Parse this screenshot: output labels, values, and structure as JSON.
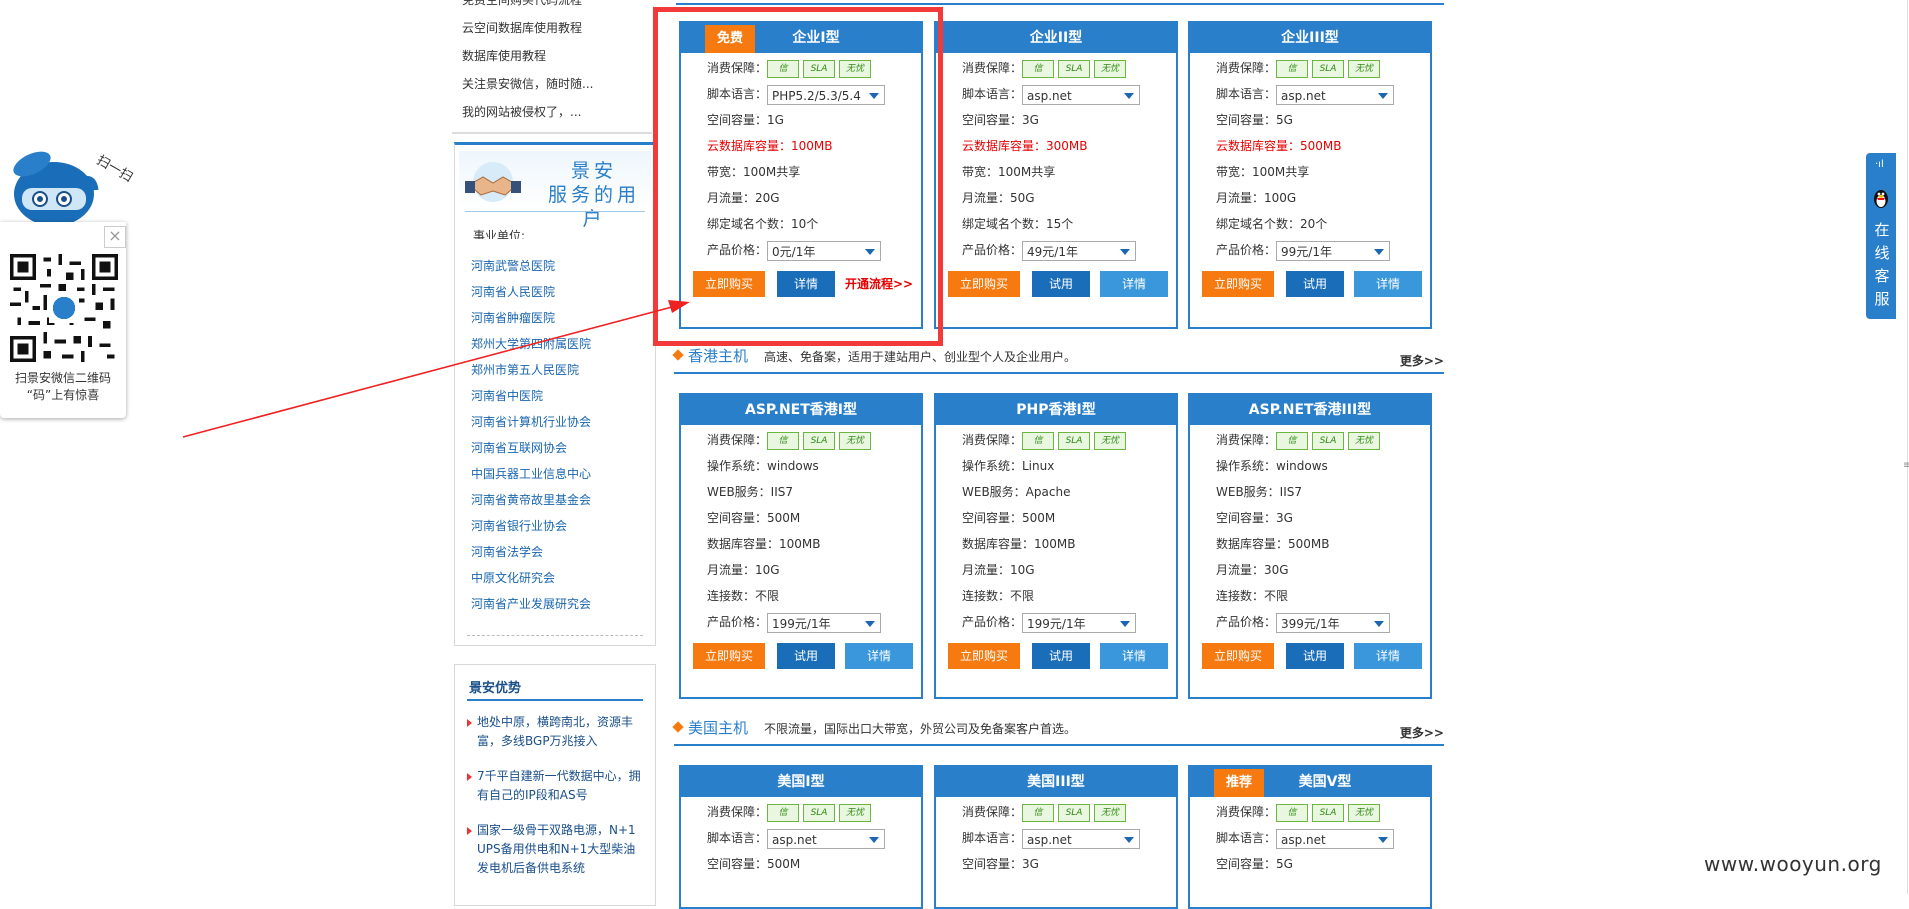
{
  "qr_widget": {
    "scan_text": "扫一扫",
    "caption_line1": "扫景安微信二维码",
    "caption_line2": "“码”上有惊喜",
    "close_symbol": "×"
  },
  "help_links": [
    "免费空间购买代码流程",
    "云空间数据库使用教程",
    "数据库使用教程",
    "关注景安微信，随时随...",
    "我的网站被侵权了，..."
  ],
  "clients": {
    "banner_line1": "景安",
    "banner_line2": "服务的用户",
    "heading": "事业单位:",
    "items": [
      "河南武警总医院",
      "河南省人民医院",
      "河南省肿瘤医院",
      "郑州大学第四附属医院",
      "郑州市第五人民医院",
      "河南省中医院",
      "河南省计算机行业协会",
      "河南省互联网协会",
      "中国兵器工业信息中心",
      "河南省黄帝故里基金会",
      "河南省银行业协会",
      "河南省法学会",
      "中原文化研究会",
      "河南省产业发展研究会"
    ]
  },
  "advantages": {
    "title": "景安优势",
    "items": [
      [
        "地处中原，横跨南北，资源丰",
        "富，多线BGP万兆接入"
      ],
      [
        "7千平自建新一代数据中心，拥",
        "有自己的IP段和AS号"
      ],
      [
        "国家一级骨干双路电源，N+1",
        "UPS备用供电和N+1大型柴油",
        "发电机后备供电系统"
      ]
    ]
  },
  "guard_icons": [
    "信",
    "SLA",
    "无忧"
  ],
  "sections": {
    "hk": {
      "title": "香港主机",
      "desc": "高速、免备案，适用于建站用户、创业型个人及企业用户。",
      "more": "更多>>"
    },
    "us": {
      "title": "美国主机",
      "desc": "不限流量，国际出口大带宽，外贸公司及免备案客户首选。",
      "more": "更多>>"
    }
  },
  "cards": {
    "c1": {
      "badge": "免费",
      "title": "企业I型",
      "guard": "消费保障：",
      "lang_label": "脚本语言：",
      "lang_value": "PHP5.2/5.3/5.4",
      "space": "空间容量：1G",
      "db": "云数据库容量：100MB",
      "bw": "带宽：100M共享",
      "traffic": "月流量：20G",
      "domains": "绑定域名个数：10个",
      "price_label": "产品价格：",
      "price_value": "0元/1年",
      "btn_buy": "立即购买",
      "btn_detail": "详情",
      "flow": "开通流程>>"
    },
    "c2": {
      "title": "企业II型",
      "guard": "消费保障：",
      "lang_label": "脚本语言：",
      "lang_value": "asp.net",
      "space": "空间容量：3G",
      "db": "云数据库容量：300MB",
      "bw": "带宽：100M共享",
      "traffic": "月流量：50G",
      "domains": "绑定域名个数：15个",
      "price_label": "产品价格：",
      "price_value": "49元/1年",
      "btn_buy": "立即购买",
      "btn_try": "试用",
      "btn_detail": "详情"
    },
    "c3": {
      "title": "企业III型",
      "guard": "消费保障：",
      "lang_label": "脚本语言：",
      "lang_value": "asp.net",
      "space": "空间容量：5G",
      "db": "云数据库容量：500MB",
      "bw": "带宽：100M共享",
      "traffic": "月流量：100G",
      "domains": "绑定域名个数：20个",
      "price_label": "产品价格：",
      "price_value": "99元/1年",
      "btn_buy": "立即购买",
      "btn_try": "试用",
      "btn_detail": "详情"
    },
    "h1": {
      "title": "ASP.NET香港I型",
      "guard": "消费保障：",
      "os": "操作系统：windows",
      "web": "WEB服务：IIS7",
      "space": "空间容量：500M",
      "db": "数据库容量：100MB",
      "traffic": "月流量：10G",
      "conn": "连接数：不限",
      "price_label": "产品价格：",
      "price_value": "199元/1年",
      "btn_buy": "立即购买",
      "btn_try": "试用",
      "btn_detail": "详情"
    },
    "h2": {
      "title": "PHP香港I型",
      "guard": "消费保障：",
      "os": "操作系统：Linux",
      "web": "WEB服务：Apache",
      "space": "空间容量：500M",
      "db": "数据库容量：100MB",
      "traffic": "月流量：10G",
      "conn": "连接数：不限",
      "price_label": "产品价格：",
      "price_value": "199元/1年",
      "btn_buy": "立即购买",
      "btn_try": "试用",
      "btn_detail": "详情"
    },
    "h3": {
      "title": "ASP.NET香港III型",
      "guard": "消费保障：",
      "os": "操作系统：windows",
      "web": "WEB服务：IIS7",
      "space": "空间容量：3G",
      "db": "数据库容量：500MB",
      "traffic": "月流量：30G",
      "conn": "连接数：不限",
      "price_label": "产品价格：",
      "price_value": "399元/1年",
      "btn_buy": "立即购买",
      "btn_try": "试用",
      "btn_detail": "详情"
    },
    "u1": {
      "title": "美国I型",
      "guard": "消费保障：",
      "lang_label": "脚本语言：",
      "lang_value": "asp.net",
      "space": "空间容量：500M"
    },
    "u2": {
      "title": "美国III型",
      "guard": "消费保障：",
      "lang_label": "脚本语言：",
      "lang_value": "asp.net",
      "space": "空间容量：3G"
    },
    "u3": {
      "badge": "推荐",
      "title": "美国V型",
      "guard": "消费保障：",
      "lang_label": "脚本语言：",
      "lang_value": "asp.net",
      "space": "空间容量：5G"
    }
  },
  "online_cs": {
    "text": "在线客服",
    "signal": "·ıl"
  },
  "watermark": "www.wooyun.org",
  "colors": {
    "brand_blue": "#2a7fcb",
    "buy_orange": "#f77a10",
    "try_blue": "#1a6db8",
    "detail_blue": "#3a97db",
    "highlight_red": "#f33a3a",
    "price_red": "#e60000"
  }
}
